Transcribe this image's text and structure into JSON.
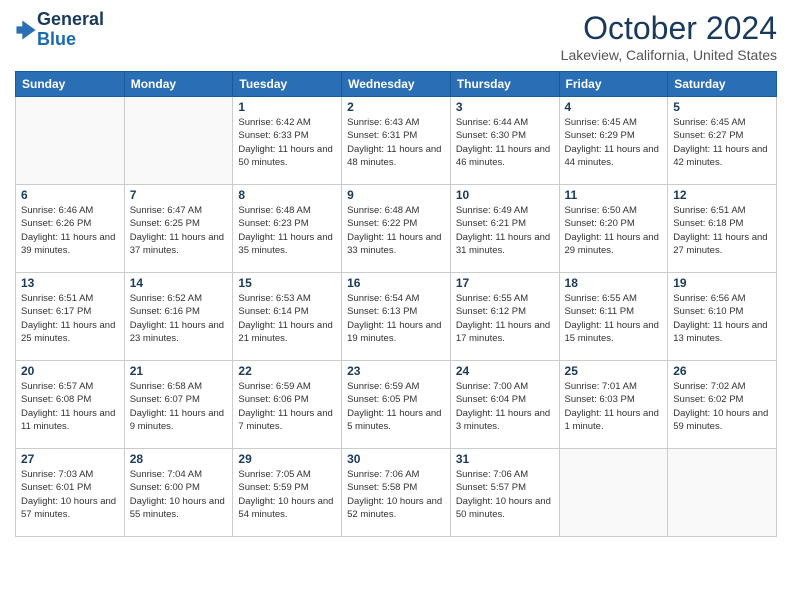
{
  "header": {
    "title": "October 2024",
    "location": "Lakeview, California, United States"
  },
  "days": [
    "Sunday",
    "Monday",
    "Tuesday",
    "Wednesday",
    "Thursday",
    "Friday",
    "Saturday"
  ],
  "weeks": [
    [
      {
        "day": "",
        "sunrise": "",
        "sunset": "",
        "daylight": ""
      },
      {
        "day": "",
        "sunrise": "",
        "sunset": "",
        "daylight": ""
      },
      {
        "day": "1",
        "sunrise": "Sunrise: 6:42 AM",
        "sunset": "Sunset: 6:33 PM",
        "daylight": "Daylight: 11 hours and 50 minutes."
      },
      {
        "day": "2",
        "sunrise": "Sunrise: 6:43 AM",
        "sunset": "Sunset: 6:31 PM",
        "daylight": "Daylight: 11 hours and 48 minutes."
      },
      {
        "day": "3",
        "sunrise": "Sunrise: 6:44 AM",
        "sunset": "Sunset: 6:30 PM",
        "daylight": "Daylight: 11 hours and 46 minutes."
      },
      {
        "day": "4",
        "sunrise": "Sunrise: 6:45 AM",
        "sunset": "Sunset: 6:29 PM",
        "daylight": "Daylight: 11 hours and 44 minutes."
      },
      {
        "day": "5",
        "sunrise": "Sunrise: 6:45 AM",
        "sunset": "Sunset: 6:27 PM",
        "daylight": "Daylight: 11 hours and 42 minutes."
      }
    ],
    [
      {
        "day": "6",
        "sunrise": "Sunrise: 6:46 AM",
        "sunset": "Sunset: 6:26 PM",
        "daylight": "Daylight: 11 hours and 39 minutes."
      },
      {
        "day": "7",
        "sunrise": "Sunrise: 6:47 AM",
        "sunset": "Sunset: 6:25 PM",
        "daylight": "Daylight: 11 hours and 37 minutes."
      },
      {
        "day": "8",
        "sunrise": "Sunrise: 6:48 AM",
        "sunset": "Sunset: 6:23 PM",
        "daylight": "Daylight: 11 hours and 35 minutes."
      },
      {
        "day": "9",
        "sunrise": "Sunrise: 6:48 AM",
        "sunset": "Sunset: 6:22 PM",
        "daylight": "Daylight: 11 hours and 33 minutes."
      },
      {
        "day": "10",
        "sunrise": "Sunrise: 6:49 AM",
        "sunset": "Sunset: 6:21 PM",
        "daylight": "Daylight: 11 hours and 31 minutes."
      },
      {
        "day": "11",
        "sunrise": "Sunrise: 6:50 AM",
        "sunset": "Sunset: 6:20 PM",
        "daylight": "Daylight: 11 hours and 29 minutes."
      },
      {
        "day": "12",
        "sunrise": "Sunrise: 6:51 AM",
        "sunset": "Sunset: 6:18 PM",
        "daylight": "Daylight: 11 hours and 27 minutes."
      }
    ],
    [
      {
        "day": "13",
        "sunrise": "Sunrise: 6:51 AM",
        "sunset": "Sunset: 6:17 PM",
        "daylight": "Daylight: 11 hours and 25 minutes."
      },
      {
        "day": "14",
        "sunrise": "Sunrise: 6:52 AM",
        "sunset": "Sunset: 6:16 PM",
        "daylight": "Daylight: 11 hours and 23 minutes."
      },
      {
        "day": "15",
        "sunrise": "Sunrise: 6:53 AM",
        "sunset": "Sunset: 6:14 PM",
        "daylight": "Daylight: 11 hours and 21 minutes."
      },
      {
        "day": "16",
        "sunrise": "Sunrise: 6:54 AM",
        "sunset": "Sunset: 6:13 PM",
        "daylight": "Daylight: 11 hours and 19 minutes."
      },
      {
        "day": "17",
        "sunrise": "Sunrise: 6:55 AM",
        "sunset": "Sunset: 6:12 PM",
        "daylight": "Daylight: 11 hours and 17 minutes."
      },
      {
        "day": "18",
        "sunrise": "Sunrise: 6:55 AM",
        "sunset": "Sunset: 6:11 PM",
        "daylight": "Daylight: 11 hours and 15 minutes."
      },
      {
        "day": "19",
        "sunrise": "Sunrise: 6:56 AM",
        "sunset": "Sunset: 6:10 PM",
        "daylight": "Daylight: 11 hours and 13 minutes."
      }
    ],
    [
      {
        "day": "20",
        "sunrise": "Sunrise: 6:57 AM",
        "sunset": "Sunset: 6:08 PM",
        "daylight": "Daylight: 11 hours and 11 minutes."
      },
      {
        "day": "21",
        "sunrise": "Sunrise: 6:58 AM",
        "sunset": "Sunset: 6:07 PM",
        "daylight": "Daylight: 11 hours and 9 minutes."
      },
      {
        "day": "22",
        "sunrise": "Sunrise: 6:59 AM",
        "sunset": "Sunset: 6:06 PM",
        "daylight": "Daylight: 11 hours and 7 minutes."
      },
      {
        "day": "23",
        "sunrise": "Sunrise: 6:59 AM",
        "sunset": "Sunset: 6:05 PM",
        "daylight": "Daylight: 11 hours and 5 minutes."
      },
      {
        "day": "24",
        "sunrise": "Sunrise: 7:00 AM",
        "sunset": "Sunset: 6:04 PM",
        "daylight": "Daylight: 11 hours and 3 minutes."
      },
      {
        "day": "25",
        "sunrise": "Sunrise: 7:01 AM",
        "sunset": "Sunset: 6:03 PM",
        "daylight": "Daylight: 11 hours and 1 minute."
      },
      {
        "day": "26",
        "sunrise": "Sunrise: 7:02 AM",
        "sunset": "Sunset: 6:02 PM",
        "daylight": "Daylight: 10 hours and 59 minutes."
      }
    ],
    [
      {
        "day": "27",
        "sunrise": "Sunrise: 7:03 AM",
        "sunset": "Sunset: 6:01 PM",
        "daylight": "Daylight: 10 hours and 57 minutes."
      },
      {
        "day": "28",
        "sunrise": "Sunrise: 7:04 AM",
        "sunset": "Sunset: 6:00 PM",
        "daylight": "Daylight: 10 hours and 55 minutes."
      },
      {
        "day": "29",
        "sunrise": "Sunrise: 7:05 AM",
        "sunset": "Sunset: 5:59 PM",
        "daylight": "Daylight: 10 hours and 54 minutes."
      },
      {
        "day": "30",
        "sunrise": "Sunrise: 7:06 AM",
        "sunset": "Sunset: 5:58 PM",
        "daylight": "Daylight: 10 hours and 52 minutes."
      },
      {
        "day": "31",
        "sunrise": "Sunrise: 7:06 AM",
        "sunset": "Sunset: 5:57 PM",
        "daylight": "Daylight: 10 hours and 50 minutes."
      },
      {
        "day": "",
        "sunrise": "",
        "sunset": "",
        "daylight": ""
      },
      {
        "day": "",
        "sunrise": "",
        "sunset": "",
        "daylight": ""
      }
    ]
  ]
}
